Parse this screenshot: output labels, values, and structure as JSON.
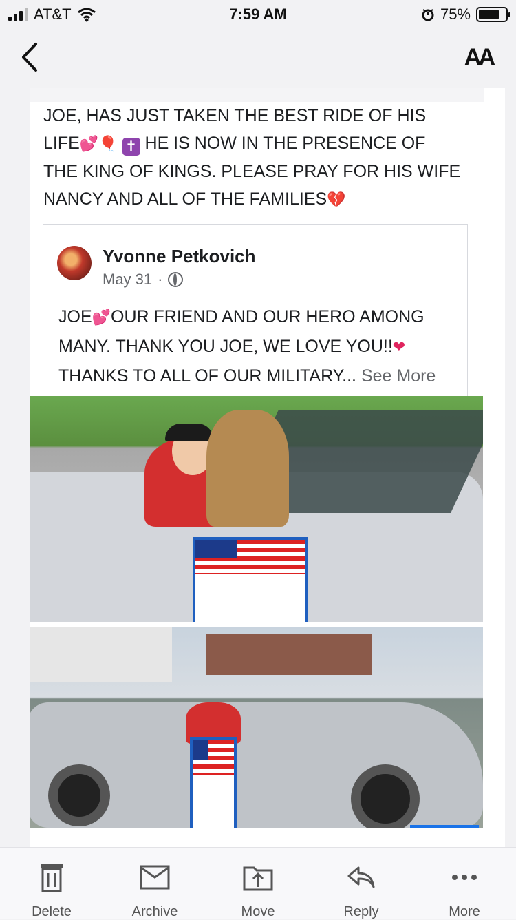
{
  "status_bar": {
    "carrier": "AT&T",
    "time": "7:59 AM",
    "battery_percent": "75%",
    "battery_level": 0.75
  },
  "nav": {
    "back_icon": "chevron-left-icon",
    "text_size_label": "AA"
  },
  "post": {
    "line1": "JOE, HAS JUST TAKEN THE BEST RIDE OF HIS",
    "line2_a": "LIFE",
    "line2_b": " HE IS NOW IN THE PRESENCE OF",
    "line3": "THE KING OF KINGS.  PLEASE PRAY FOR HIS WIFE",
    "line4": "NANCY AND ALL OF THE FAMILIES",
    "emoji_heart": "💕",
    "emoji_balloon": "🎈",
    "emoji_cross": "✝",
    "emoji_broken_heart": "💔"
  },
  "shared_post": {
    "author": "Yvonne Petkovich",
    "date": "May 31",
    "separator": "·",
    "line1_a": "JOE",
    "line1_b": "OUR FRIEND AND OUR HERO AMONG",
    "line2": "MANY.  THANK YOU JOE, WE LOVE YOU!!",
    "line3": "THANKS TO ALL OF OUR MILITARY...",
    "see_more": "See More",
    "emoji_heart": "💕",
    "emoji_red_heart": "❤"
  },
  "toolbar": {
    "items": [
      {
        "label": "Delete",
        "icon": "trash-icon"
      },
      {
        "label": "Archive",
        "icon": "archive-icon"
      },
      {
        "label": "Move",
        "icon": "move-icon"
      },
      {
        "label": "Reply",
        "icon": "reply-icon"
      },
      {
        "label": "More",
        "icon": "more-icon"
      }
    ]
  }
}
